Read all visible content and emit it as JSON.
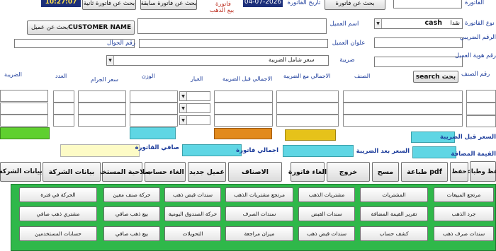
{
  "colors": {
    "green_panel": "#2fb84a",
    "green_bar": "#5fd02f",
    "cyan": "#5fd6e4",
    "orange": "#e28a1d",
    "gold": "#e6c21a",
    "light_yellow": "#fdfbc6",
    "invoice_no_bg": "#1c2f7a",
    "date_bg": "#1c2f7a"
  },
  "top": {
    "invoice_no": "10:27:07",
    "second_invoice_search": "بحث عن فاتورة ثانية",
    "prev_invoice_search": "بحث عن فاتورة سابقة",
    "gold_sale_label_1": "فاتورة",
    "gold_sale_label_2": "بيع الذهب",
    "invoice_date_label": "تاريخ الفاتورة",
    "invoice_date": "04-07-2026",
    "invoice_search_btn": "بحث عن فاتورة",
    "invoice_label": "الفاتورة"
  },
  "customer": {
    "search_btn": "بحث عن عميل",
    "name_value": "CUSTOMER NAME",
    "name_label": "اسم العميل",
    "invoice_type_label": "نوع الفاتورة",
    "invoice_type_value": "cash",
    "invoice_type_ar": "نقدا",
    "mobile_label": "رقم الجوال",
    "address_label": "علوان العميل",
    "tax_no_label": "الرقم الضريبي",
    "tax_label": "ضريبة",
    "id_label": "رقم هوية العميل",
    "price_mode": "سعر شامل الضريبة"
  },
  "items": {
    "item_no_label": "رقم الصنف",
    "search_btn": "search بحث",
    "headers": {
      "item": "الصنف",
      "total_with_tax": "الاجمالي مع الضريبة",
      "total_before_tax": "الاجمالي قبل الضريبة",
      "karat": "العيار",
      "weight": "الوزن",
      "gram_price": "سعر الجرام",
      "count": "العدد",
      "tax": "الضريبة"
    }
  },
  "totals": {
    "price_before_tax_label": "السعر قبل الضريبة",
    "vat_label": "القيمة المضافة",
    "price_after_tax_label": "السعر بعد الضريبة",
    "invoice_total_label": "اجمالي فاتورة",
    "invoice_net_label": "صافي الفاتورة"
  },
  "actions": [
    "حفظ وطباعة",
    "حفظ",
    "طباعة pdf",
    "مسح",
    "خروج",
    "الغاء فاتورة",
    "الاصناف",
    "عميل جديد",
    "الغاء حساب",
    "صلاحية المستخدم",
    "بيانات  الشركة"
  ],
  "nav": {
    "row1": [
      "مرتجع المبيعات",
      "المشتريات",
      "مشتريات الذهب",
      "مرتجع مشتريات الذهب",
      "سندات قبض ذهب",
      "حركة صنف معين",
      "الحركة في فترة"
    ],
    "row2": [
      "جرد الذهب",
      "تقرير القيمة المضافة",
      "سندات القبض",
      "سندات الصرف",
      "حركة الصندوق اليومية",
      "بيع ذهب صافي",
      "مشتري ذهب صافي"
    ],
    "row3": [
      "سندات صرف ذهب",
      "كشف حساب",
      "سندات قبض ذهب",
      "ميزان مراجعة",
      "التحويلات",
      "بيع ذهب صافي",
      "حسابات المستخدمين"
    ]
  }
}
